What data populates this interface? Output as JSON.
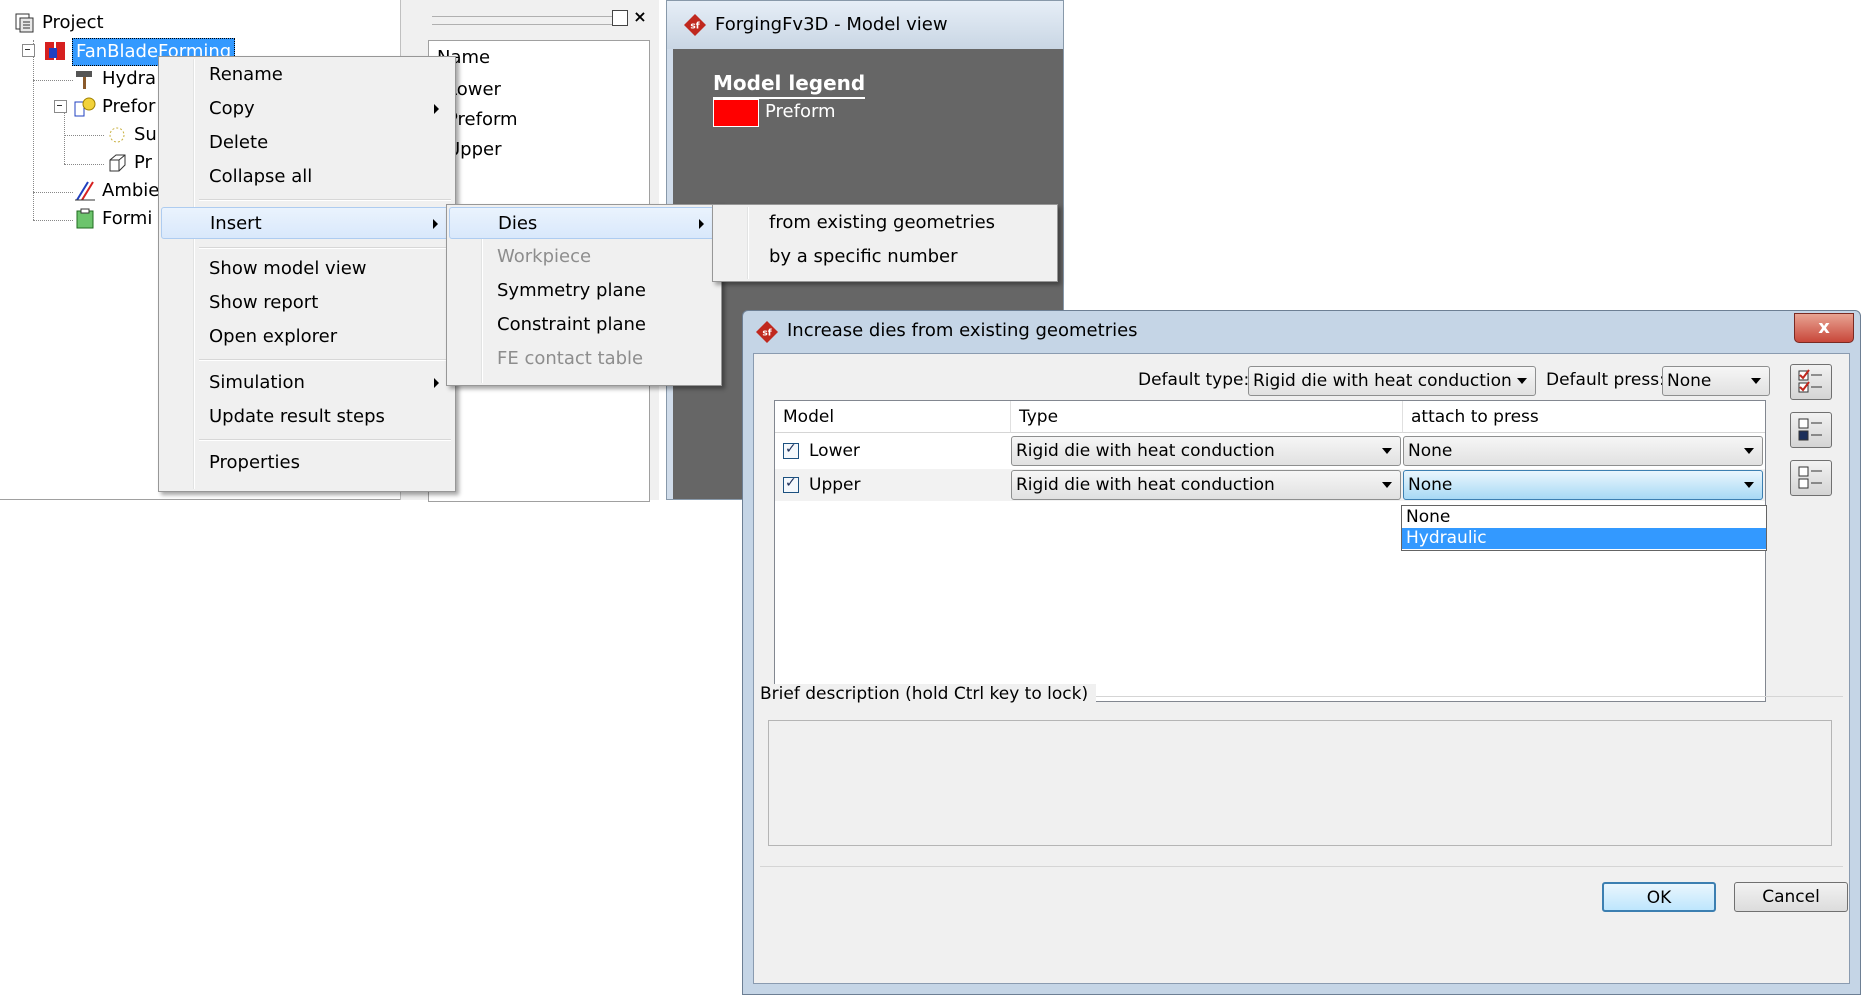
{
  "tree": {
    "items": [
      {
        "label": "Project"
      },
      {
        "label": "FanBladeForming"
      },
      {
        "label": "Hydra"
      },
      {
        "label": "Prefor"
      },
      {
        "label": "Su"
      },
      {
        "label": "Pr"
      },
      {
        "label": "Ambie"
      },
      {
        "label": "Formi"
      }
    ]
  },
  "name_list": {
    "header": "Name",
    "items": [
      "Lower",
      "Preform",
      "Upper"
    ]
  },
  "model_view": {
    "title": "ForgingFv3D - Model view",
    "legend_title": "Model legend",
    "legend_items": [
      {
        "label": "Preform",
        "color": "#ff0000"
      }
    ]
  },
  "context_menu": {
    "items": [
      "Rename",
      "Copy",
      "Delete",
      "Collapse all",
      "Insert",
      "Show model view",
      "Show report",
      "Open explorer",
      "Simulation",
      "Update result steps",
      "Properties"
    ]
  },
  "insert_menu": {
    "items": [
      "Dies",
      "Workpiece",
      "Symmetry plane",
      "Constraint plane",
      "FE contact table"
    ]
  },
  "dies_menu": {
    "items": [
      "from existing geometries",
      "by a specific number"
    ]
  },
  "dialog": {
    "title": "Increase dies from existing geometries",
    "close_label": "x",
    "default_type_label": "Default type:",
    "default_type_value": "Rigid die with heat conduction",
    "default_press_label": "Default press:",
    "default_press_value": "None",
    "columns": [
      "Model",
      "Type",
      "attach to press"
    ],
    "rows": [
      {
        "model": "Lower",
        "type": "Rigid die with heat conduction",
        "press": "None",
        "checked": true
      },
      {
        "model": "Upper",
        "type": "Rigid die with heat conduction",
        "press": "None",
        "checked": true
      }
    ],
    "press_options": [
      "None",
      "Hydraulic"
    ],
    "description_label": "Brief description (hold Ctrl key to lock)",
    "ok_label": "OK",
    "cancel_label": "Cancel"
  },
  "colors": {
    "selection": "#3399ff",
    "menu_highlight": "#d9e8fb",
    "legend_preform": "#ff0000",
    "model_view_bg": "#666666"
  }
}
